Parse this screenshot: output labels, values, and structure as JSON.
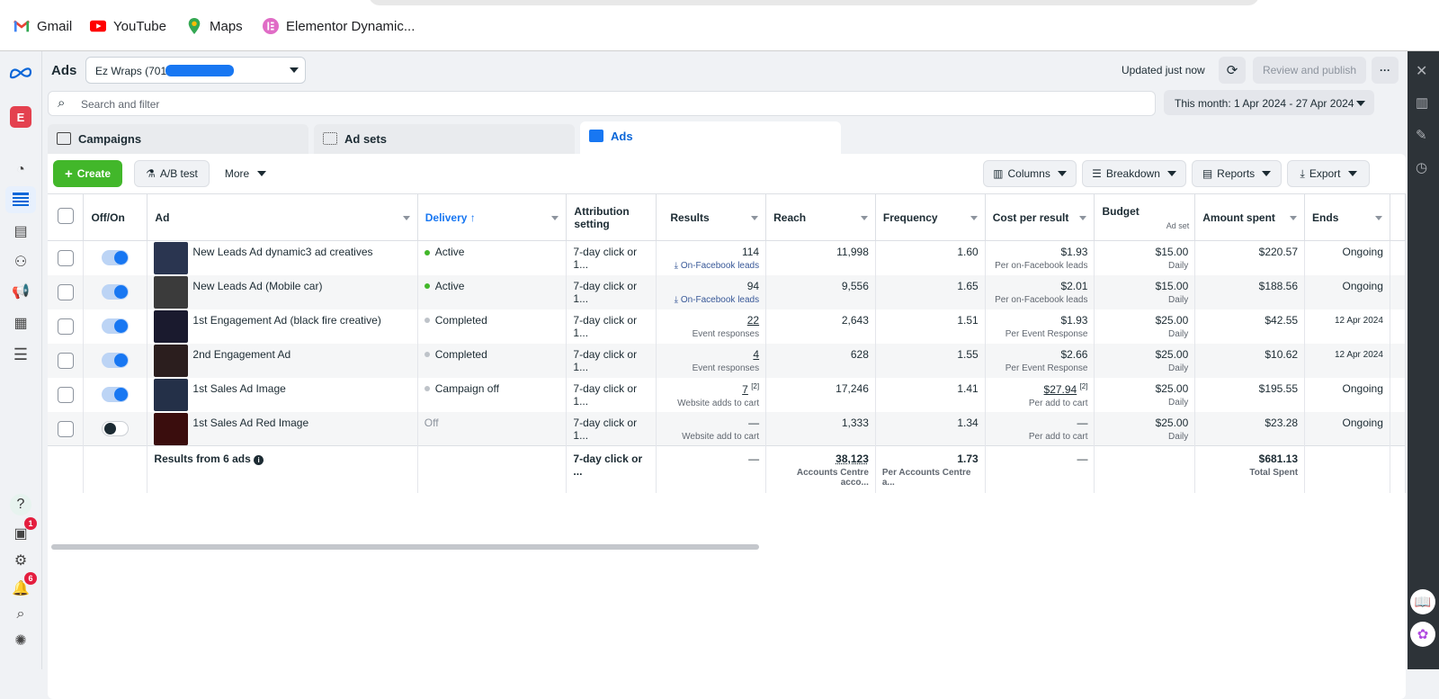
{
  "bookmarks": [
    {
      "label": "Gmail",
      "icon": "gmail-icon"
    },
    {
      "label": "YouTube",
      "icon": "youtube-icon"
    },
    {
      "label": "Maps",
      "icon": "maps-icon"
    },
    {
      "label": "Elementor Dynamic...",
      "icon": "elementor-icon"
    }
  ],
  "rail": {
    "account_initial": "E",
    "help": "?",
    "notifications_badge": "1",
    "alerts_badge": "6"
  },
  "header": {
    "title": "Ads",
    "account_name": "Ez Wraps (70101",
    "updated": "Updated just now",
    "review_publish": "Review and publish",
    "more": "···"
  },
  "search": {
    "placeholder": "Search and filter"
  },
  "date_range": "This month: 1 Apr 2024 - 27 Apr 2024",
  "tabs": [
    {
      "label": "Campaigns"
    },
    {
      "label": "Ad sets"
    },
    {
      "label": "Ads"
    }
  ],
  "toolbar": {
    "create": "Create",
    "ab_test": "A/B test",
    "more": "More",
    "columns": "Columns",
    "breakdown": "Breakdown",
    "reports": "Reports",
    "export": "Export"
  },
  "columns": {
    "offon": "Off/On",
    "ad": "Ad",
    "delivery": "Delivery",
    "attribution": "Attribution setting",
    "results": "Results",
    "reach": "Reach",
    "frequency": "Frequency",
    "cpr": "Cost per result",
    "budget": "Budget",
    "budget_sub": "Ad set",
    "spent": "Amount spent",
    "ends": "Ends"
  },
  "rows": [
    {
      "name": "New Leads Ad dynamic3 ad creatives",
      "on": true,
      "delivery": "Active",
      "attribution": "7-day click or 1...",
      "results": "114",
      "results_sub": "On-Facebook leads",
      "reach": "11,998",
      "frequency": "1.60",
      "cpr": "$1.93",
      "cpr_sub": "Per on-Facebook leads",
      "budget": "$15.00",
      "budget_sub": "Daily",
      "spent": "$220.57",
      "ends": "Ongoing"
    },
    {
      "name": "New Leads Ad (Mobile car)",
      "on": true,
      "delivery": "Active",
      "attribution": "7-day click or 1...",
      "results": "94",
      "results_sub": "On-Facebook leads",
      "reach": "9,556",
      "frequency": "1.65",
      "cpr": "$2.01",
      "cpr_sub": "Per on-Facebook leads",
      "budget": "$15.00",
      "budget_sub": "Daily",
      "spent": "$188.56",
      "ends": "Ongoing"
    },
    {
      "name": "1st Engagement Ad (black fire creative)",
      "on": true,
      "delivery": "Completed",
      "attribution": "7-day click or 1...",
      "results": "22",
      "results_sub": "Event responses",
      "reach": "2,643",
      "frequency": "1.51",
      "cpr": "$1.93",
      "cpr_sub": "Per Event Response",
      "budget": "$25.00",
      "budget_sub": "Daily",
      "spent": "$42.55",
      "ends": "12 Apr 2024"
    },
    {
      "name": "2nd Engagement Ad",
      "on": true,
      "delivery": "Completed",
      "attribution": "7-day click or 1...",
      "results": "4",
      "results_sub": "Event responses",
      "reach": "628",
      "frequency": "1.55",
      "cpr": "$2.66",
      "cpr_sub": "Per Event Response",
      "budget": "$25.00",
      "budget_sub": "Daily",
      "spent": "$10.62",
      "ends": "12 Apr 2024"
    },
    {
      "name": "1st Sales Ad Image",
      "on": true,
      "delivery": "Campaign off",
      "attribution": "7-day click or 1...",
      "results": "7",
      "results_note": "[2]",
      "results_sub": "Website adds to cart",
      "reach": "17,246",
      "frequency": "1.41",
      "cpr": "$27.94",
      "cpr_note": "[2]",
      "cpr_sub": "Per add to cart",
      "budget": "$25.00",
      "budget_sub": "Daily",
      "spent": "$195.55",
      "ends": "Ongoing"
    },
    {
      "name": "1st Sales Ad Red Image",
      "on": false,
      "delivery": "Off",
      "attribution": "7-day click or 1...",
      "results": "—",
      "results_sub": "Website add to cart",
      "reach": "1,333",
      "frequency": "1.34",
      "cpr": "—",
      "cpr_sub": "Per add to cart",
      "budget": "$25.00",
      "budget_sub": "Daily",
      "spent": "$23.28",
      "ends": "Ongoing"
    }
  ],
  "totals": {
    "label": "Results from 6 ads",
    "attribution": "7-day click or ...",
    "results": "—",
    "reach": "38,123",
    "reach_sub": "Accounts Centre acco...",
    "frequency": "1.73",
    "frequency_sub": "Per Accounts Centre a...",
    "cpr": "—",
    "spent": "$681.13",
    "spent_sub": "Total Spent"
  },
  "colors": {
    "accent": "#1877f2",
    "create_green": "#42b72a",
    "active_dot": "#42b72a",
    "inactive_dot": "#bec3c9"
  }
}
